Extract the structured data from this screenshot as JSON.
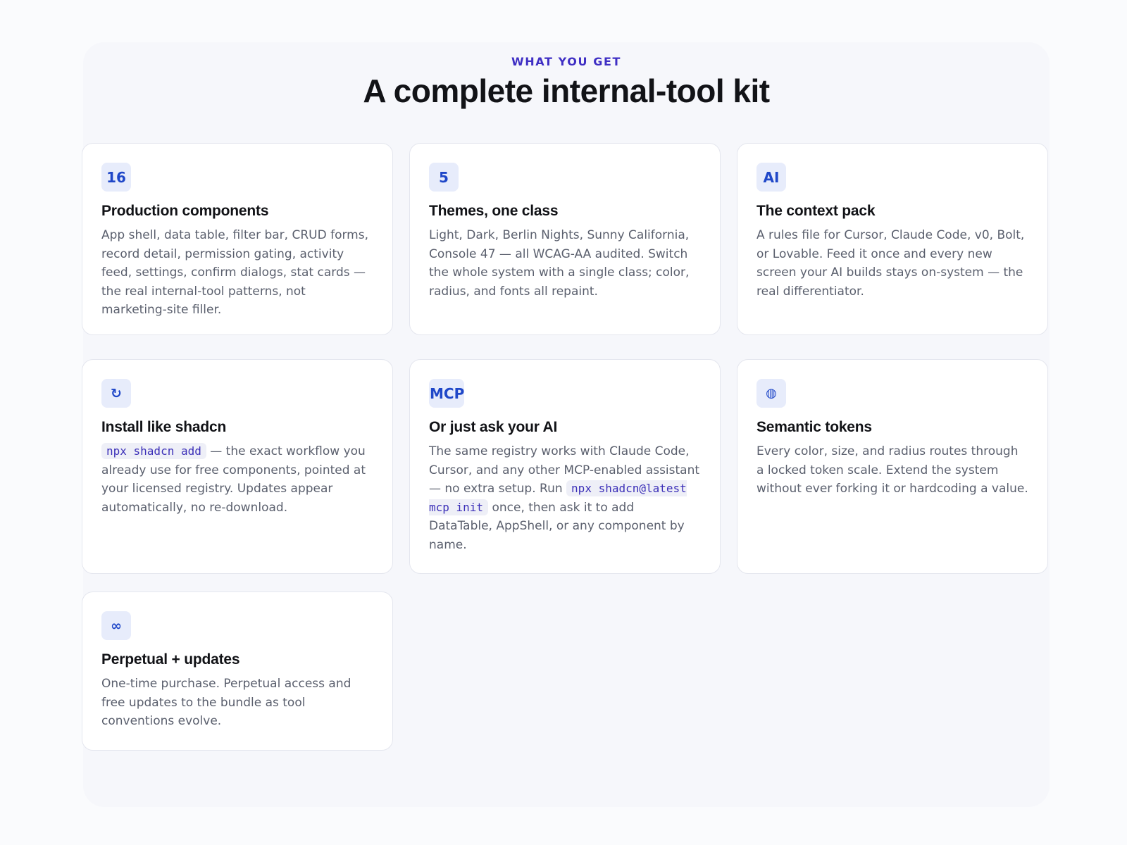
{
  "header": {
    "eyebrow": "WHAT YOU GET",
    "title": "A complete internal-tool kit"
  },
  "cards": [
    {
      "badge": "16",
      "title": "Production components",
      "body": "App shell, data table, filter bar, CRUD forms, record detail, permission gating, activity feed, settings, confirm dialogs, stat cards — the real internal-tool patterns, not marketing-site filler."
    },
    {
      "badge": "5",
      "title": "Themes, one class",
      "body": "Light, Dark, Berlin Nights, Sunny California, Console 47 — all WCAG-AA audited. Switch the whole system with a single class; color, radius, and fonts all repaint."
    },
    {
      "badge": "AI",
      "title": "The context pack",
      "body": "A rules file for Cursor, Claude Code, v0, Bolt, or Lovable. Feed it once and every new screen your AI builds stays on-system — the real differentiator."
    },
    {
      "badge": "↻",
      "icon": "refresh-icon",
      "title": "Install like shadcn",
      "code": "npx shadcn add",
      "body": " — the exact workflow you already use for free components, pointed at your licensed registry. Updates appear automatically, no re-download."
    },
    {
      "badge": "MCP",
      "title": "Or just ask your AI",
      "body_pre": "The same registry works with Claude Code, Cursor, and any other MCP-enabled assistant — no extra setup. Run ",
      "code": "npx shadcn@latest mcp init",
      "body_post": " once, then ask it to add DataTable, AppShell, or any component by name."
    },
    {
      "badge": "◍",
      "icon": "globe-icon",
      "title": "Semantic tokens",
      "body": "Every color, size, and radius routes through a locked token scale. Extend the system without ever forking it or hardcoding a value."
    },
    {
      "badge": "∞",
      "icon": "infinity-icon",
      "title": "Perpetual + updates",
      "body": "One-time purchase. Perpetual access and free updates to the bundle as tool conventions evolve."
    }
  ],
  "colors": {
    "accent": "#3f2fc4",
    "badge_text": "#1f47c8",
    "badge_bg": "#e7ecfb",
    "title": "#111216",
    "body": "#5a5f6d",
    "card_border": "#e4e6ee"
  }
}
